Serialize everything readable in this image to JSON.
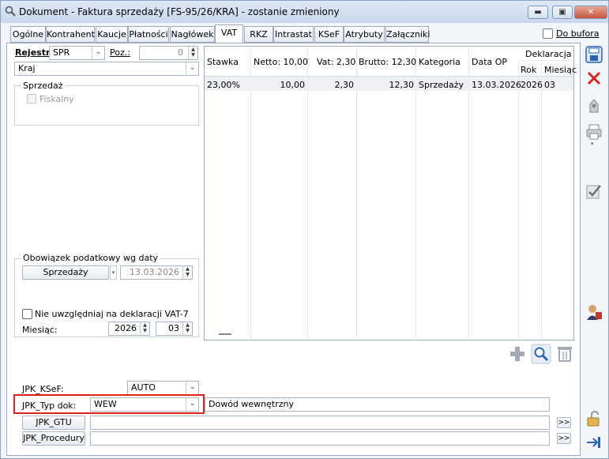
{
  "window": {
    "title": "Dokument - Faktura sprzedaży [FS-95/26/KRA]  - zostanie zmieniony",
    "minimize": "▬",
    "maximize": "▣",
    "close": "✕"
  },
  "tabs": [
    "Ogólne",
    "Kontrahent",
    "Kaucje",
    "Płatności",
    "Nagłówek",
    "VAT",
    "RKZ",
    "Intrastat",
    "KSeF",
    "Atrybuty",
    "Załączniki"
  ],
  "do_bufora": {
    "label": "Do bufora",
    "checked": false
  },
  "left": {
    "rejestr_label": "Rejestr:",
    "rejestr_value": "SPR",
    "poz_label": "Poz.:",
    "poz_value": "0",
    "region_value": "Kraj",
    "sprzedaz_label": "Sprzedaż",
    "fiskalny_label": "Fiskalny",
    "obowiazek_label": "Obowiązek podatkowy wg daty",
    "obowiazek_button": "Sprzedaży",
    "obowiazek_date": "13.03.2026",
    "nie_uwzgl_label": "Nie uwzględniaj na deklaracji VAT-7",
    "miesiac_label": "Miesiąc:",
    "rok_value": "2026",
    "miesiac_value": "03"
  },
  "table": {
    "deklaracja_label": "Deklaracja",
    "headers": {
      "stawka": "Stawka",
      "netto": "Netto: 10,00",
      "vat": "Vat: 2,30",
      "brutto": "Brutto: 12,30",
      "kategoria": "Kategoria",
      "data_op": "Data OP",
      "rok": "Rok",
      "miesiac": "Miesiąc"
    },
    "rows": [
      {
        "stawka": "23,00%",
        "netto": "10,00",
        "vat": "2,30",
        "brutto": "12,30",
        "kategoria": "Sprzedaży",
        "data_op": "13.03.2026",
        "rok": "2026",
        "miesiac": "03"
      }
    ]
  },
  "jpk": {
    "ksef_label": "JPK_KSeF:",
    "ksef_value": "AUTO",
    "typ_label": "JPK_Typ dok:",
    "typ_value": "WEW",
    "typ_desc": "Dowód wewnętrzny",
    "gtu_button": "JPK_GTU",
    "procedury_button": "JPK_Procedury",
    "more": ">>"
  },
  "colors": {
    "highlight_border": "#e0201a",
    "accent": "#2b63b8"
  }
}
